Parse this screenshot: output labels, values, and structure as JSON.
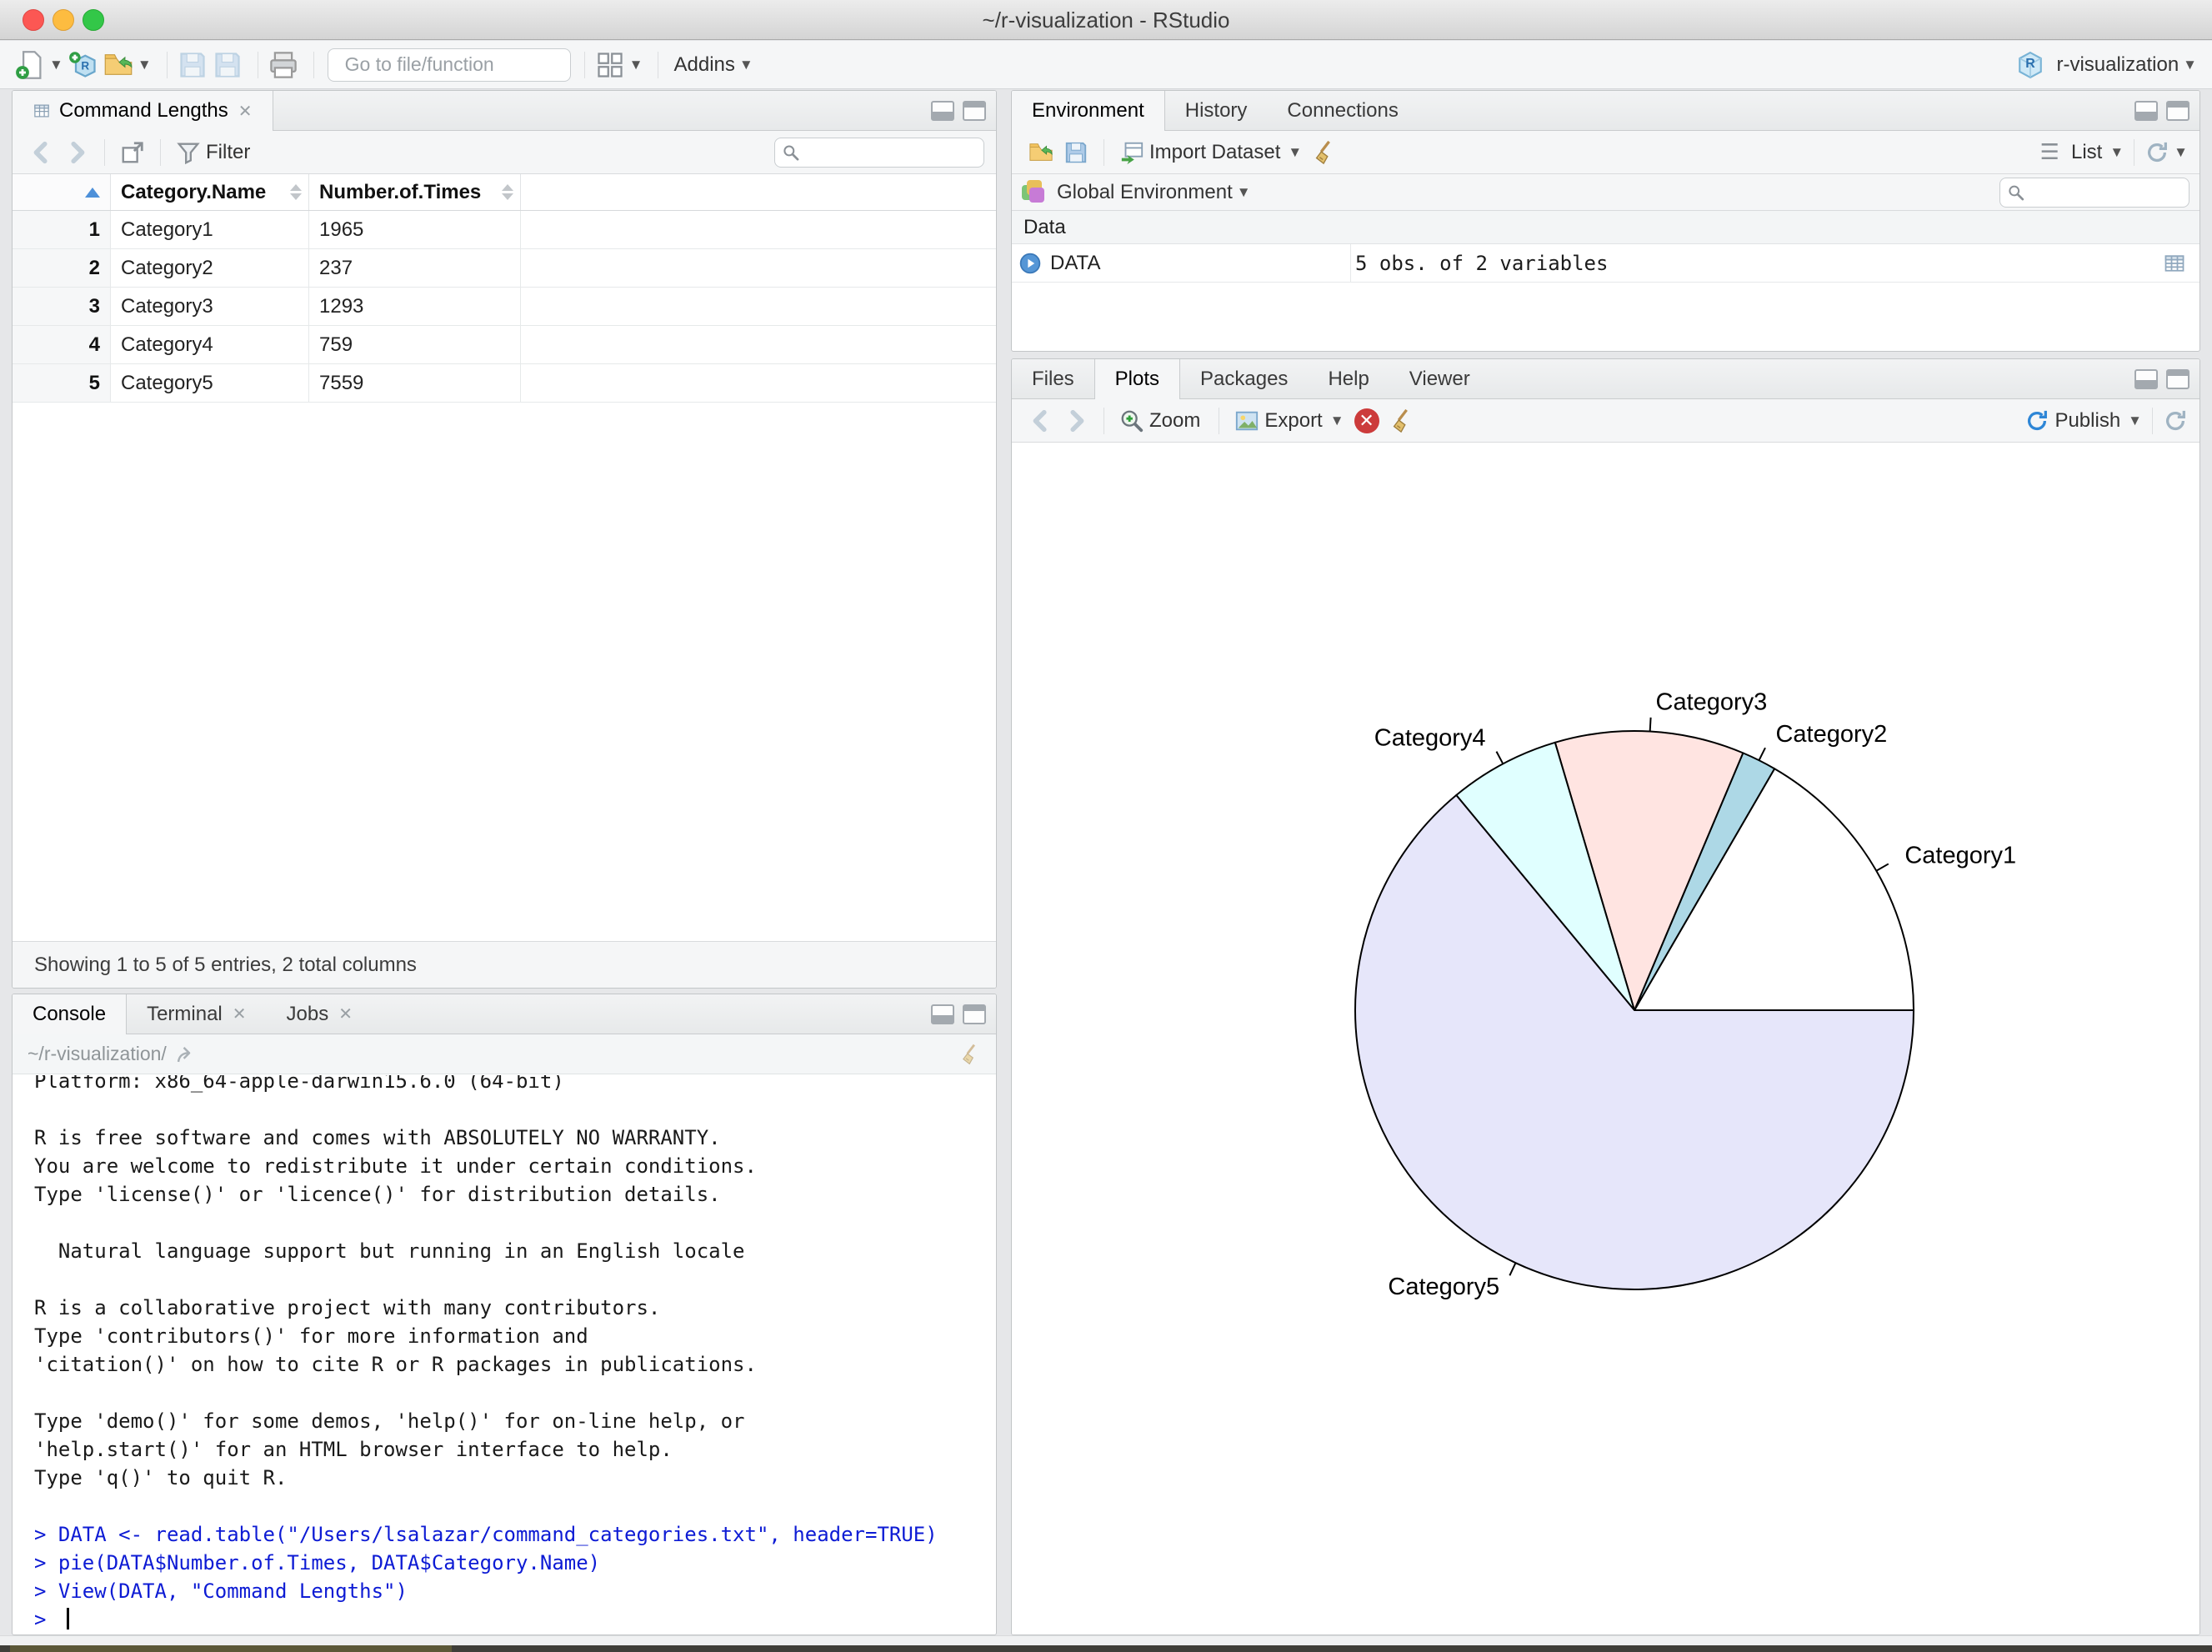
{
  "window": {
    "title": "~/r-visualization - RStudio"
  },
  "main_toolbar": {
    "goto_placeholder": "Go to file/function",
    "addins_label": "Addins",
    "project_label": "r-visualization"
  },
  "data_viewer": {
    "tab_label": "Command Lengths",
    "filter_label": "Filter",
    "columns": [
      "Category.Name",
      "Number.of.Times"
    ],
    "rows": [
      [
        "1",
        "Category1",
        "1965"
      ],
      [
        "2",
        "Category2",
        "237"
      ],
      [
        "3",
        "Category3",
        "1293"
      ],
      [
        "4",
        "Category4",
        "759"
      ],
      [
        "5",
        "Category5",
        "7559"
      ]
    ],
    "footer": "Showing 1 to 5 of 5 entries, 2 total columns"
  },
  "environment": {
    "tabs": [
      "Environment",
      "History",
      "Connections"
    ],
    "import_label": "Import Dataset",
    "list_label": "List",
    "scope_label": "Global Environment",
    "section_label": "Data",
    "object_name": "DATA",
    "object_value": "5 obs. of 2 variables"
  },
  "plots": {
    "tabs": [
      "Files",
      "Plots",
      "Packages",
      "Help",
      "Viewer"
    ],
    "zoom_label": "Zoom",
    "export_label": "Export",
    "publish_label": "Publish"
  },
  "console": {
    "tabs": [
      "Console",
      "Terminal",
      "Jobs"
    ],
    "working_dir": "~/r-visualization/",
    "prompt": ">",
    "output_lines": [
      "Platform: x86_64-apple-darwin15.6.0 (64-bit)",
      "",
      "R is free software and comes with ABSOLUTELY NO WARRANTY.",
      "You are welcome to redistribute it under certain conditions.",
      "Type 'license()' or 'licence()' for distribution details.",
      "",
      "  Natural language support but running in an English locale",
      "",
      "R is a collaborative project with many contributors.",
      "Type 'contributors()' for more information and",
      "'citation()' on how to cite R or R packages in publications.",
      "",
      "Type 'demo()' for some demos, 'help()' for on-line help, or",
      "'help.start()' for an HTML browser interface to help.",
      "Type 'q()' to quit R.",
      ""
    ],
    "commands": [
      "DATA <- read.table(\"/Users/lsalazar/command_categories.txt\", header=TRUE)",
      "pie(DATA$Number.of.Times, DATA$Category.Name)",
      "View(DATA, \"Command Lengths\")"
    ]
  },
  "chart_data": {
    "type": "pie",
    "title": "",
    "categories": [
      "Category1",
      "Category2",
      "Category3",
      "Category4",
      "Category5"
    ],
    "values": [
      1965,
      237,
      1293,
      759,
      7559
    ],
    "colors": [
      "#FFFFFF",
      "#ADD8E6",
      "#FFE4E1",
      "#E0FFFF",
      "#E6E6FA"
    ],
    "slice_border": "#000000",
    "label_color": "#000000",
    "start_angle_deg": 0,
    "direction": "counterclockwise",
    "legend_position": "none"
  }
}
